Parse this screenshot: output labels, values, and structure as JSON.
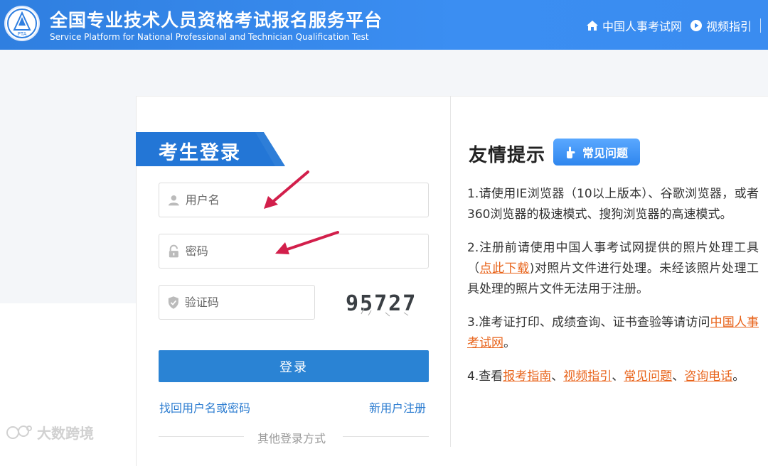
{
  "header": {
    "logo_text": "PTA",
    "title_cn": "全国专业技术人员资格考试报名服务平台",
    "title_en": "Service Platform for National Professional and Technician Qualification Test",
    "nav": [
      {
        "label": "中国人事考试网",
        "icon": "home-icon"
      },
      {
        "label": "视频指引",
        "icon": "play-circle-icon"
      }
    ]
  },
  "login": {
    "title": "考生登录",
    "username_placeholder": "用户名",
    "password_placeholder": "密码",
    "captcha_placeholder": "验证码",
    "captcha_text": "95727",
    "submit_label": "登录",
    "find_account_label": "找回用户名或密码",
    "register_label": "新用户注册",
    "other_login_label": "其他登录方式"
  },
  "tips": {
    "title": "友情提示",
    "faq_button": "常见问题",
    "items": {
      "t1": "1.请使用IE浏览器（10以上版本）、谷歌浏览器，或者360浏览器的极速模式、搜狗浏览器的高速模式。",
      "t2a": "2.注册前请使用中国人事考试网提供的照片处理工具（",
      "t2link": "点此下载",
      "t2b": ")对照片文件进行处理。未经该照片处理工具处理的照片文件无法用于注册。",
      "t3a": "3.准考证打印、成绩查询、证书查验等请访问",
      "t3link": "中国人事考试网",
      "t3b": "。",
      "t4a": "4.查看",
      "t4l1": "报考指南",
      "t4s1": "、",
      "t4l2": "视频指引",
      "t4s2": "、",
      "t4l3": "常见问题",
      "t4s3": "、",
      "t4l4": "咨询电话",
      "t4b": "。"
    }
  },
  "watermark": "大数跨境",
  "colors": {
    "header_blue": "#3a8cf0",
    "button_blue": "#2a83d4",
    "link_blue": "#2a7bd0",
    "tip_link_orange": "#e8631a",
    "annotation_arrow": "#d21f4b"
  }
}
